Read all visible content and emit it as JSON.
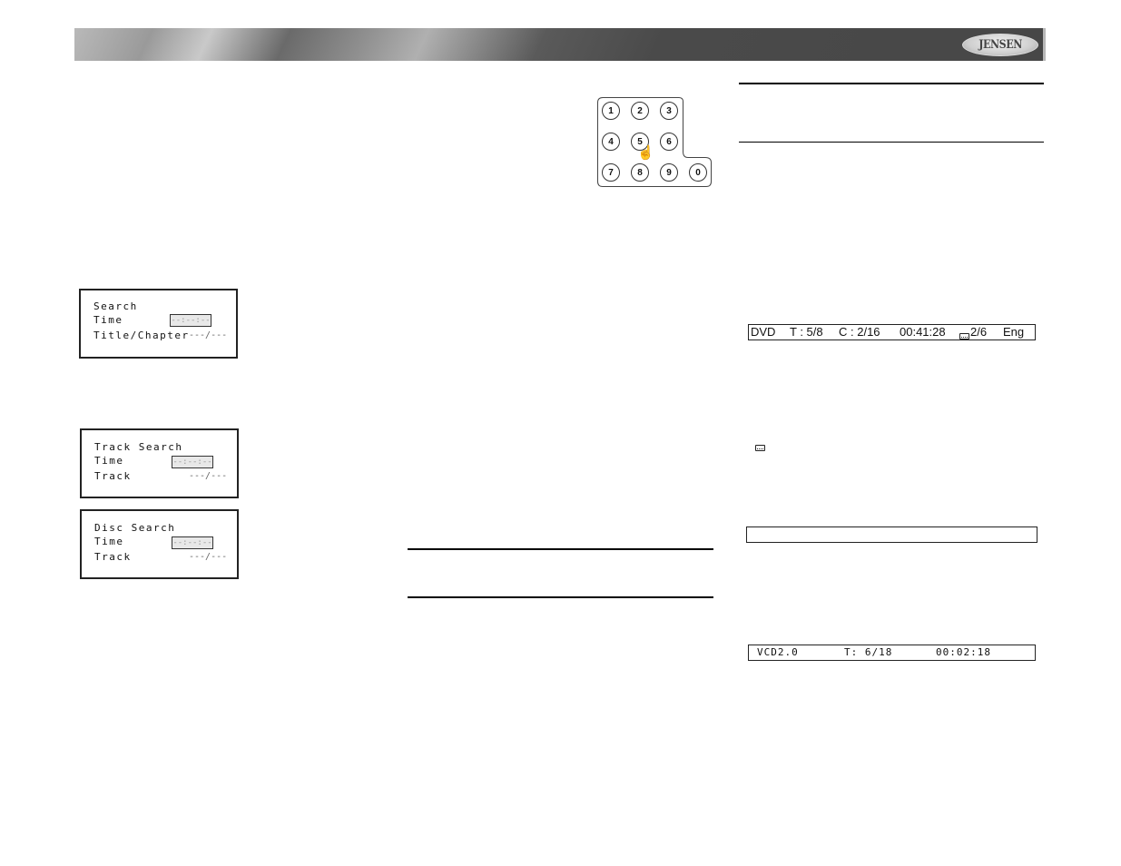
{
  "header": {
    "brand": "JENSEN"
  },
  "keypad": {
    "keys": [
      "1",
      "2",
      "3",
      "4",
      "5",
      "6",
      "7",
      "8",
      "9",
      "0"
    ],
    "pressed_key": "5",
    "pointer_icon": "hand-pointer-icon"
  },
  "dvd_search": {
    "title": "Search",
    "time_label": "Time",
    "time_value": "--:--:--",
    "chapter_label": "Title/Chapter",
    "chapter_value": "---/---"
  },
  "track_search": {
    "title": "Track Search",
    "time_label": "Time",
    "time_value": "--:--:--",
    "track_label": "Track",
    "track_value": "---/---"
  },
  "disc_search": {
    "title": "Disc Search",
    "time_label": "Time",
    "time_value": "--:--:--",
    "track_label": "Track",
    "track_value": "---/---"
  },
  "dvd_status": {
    "disc": "DVD",
    "title": "T : 5/8",
    "chapter": "C : 2/16",
    "time": "00:41:28",
    "subtitle_icon": "subtitle-icon",
    "subtitle": "2/6",
    "language": "Eng"
  },
  "inline_icon": "subtitle-icon",
  "blank_status": "",
  "vcd_status": {
    "disc": "VCD2.0",
    "track": "T: 6/18",
    "time": "00:02:18"
  }
}
